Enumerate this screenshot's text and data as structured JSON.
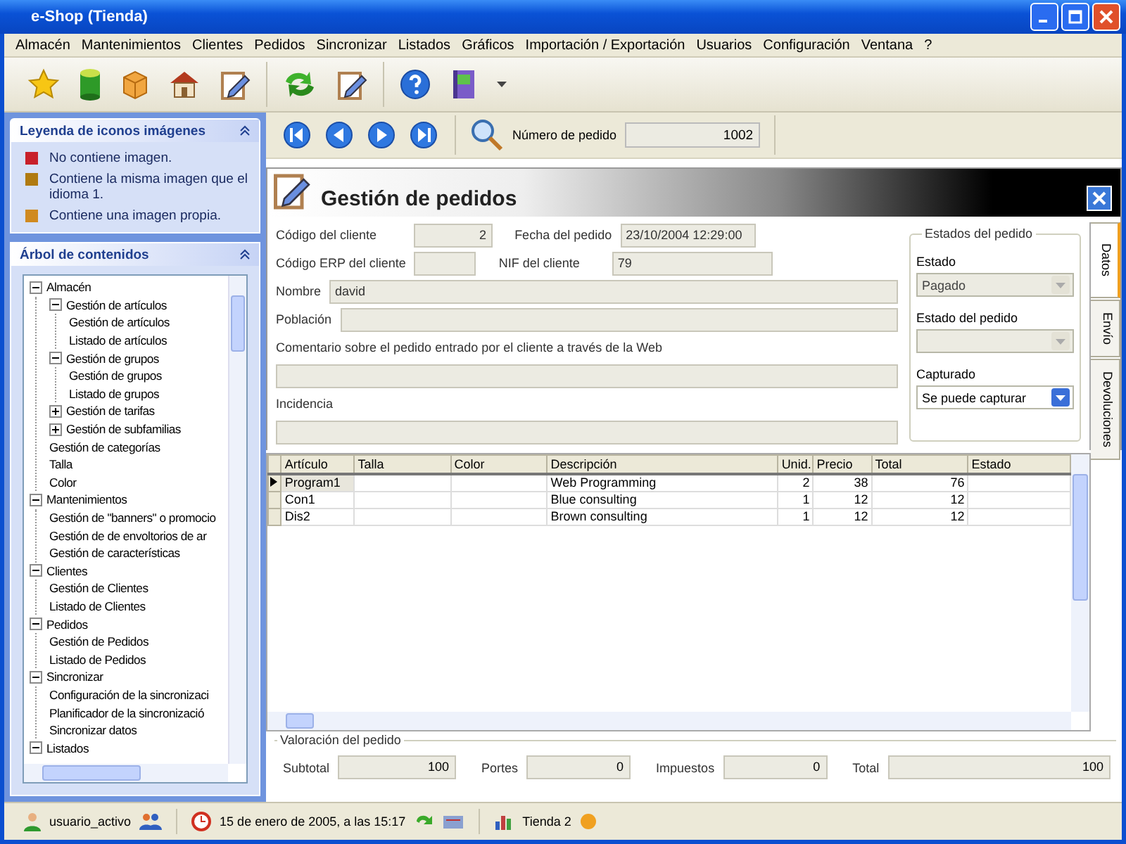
{
  "window": {
    "title": "e-Shop (Tienda)"
  },
  "menu": [
    "Almacén",
    "Mantenimientos",
    "Clientes",
    "Pedidos",
    "Sincronizar",
    "Listados",
    "Gráficos",
    "Importación / Exportación",
    "Usuarios",
    "Configuración",
    "Ventana",
    "?"
  ],
  "legend": {
    "title": "Leyenda de iconos imágenes",
    "items": [
      {
        "label": "No contiene imagen.",
        "color": "#c8202a"
      },
      {
        "label": "Contiene la misma imagen que el idioma 1.",
        "color": "#b07a10"
      },
      {
        "label": "Contiene una imagen propia.",
        "color": "#d08a20"
      }
    ]
  },
  "tree": {
    "title": "Árbol de contenidos",
    "items": [
      {
        "label": "Almacén",
        "expanded": true,
        "children": [
          {
            "label": "Gestión de artículos",
            "expanded": true,
            "children": [
              {
                "label": "Gestión de artículos"
              },
              {
                "label": "Listado de artículos"
              }
            ]
          },
          {
            "label": "Gestión de grupos",
            "expanded": true,
            "children": [
              {
                "label": "Gestión de grupos"
              },
              {
                "label": "Listado de grupos"
              }
            ]
          },
          {
            "label": "Gestión de tarifas",
            "expanded": false
          },
          {
            "label": "Gestión de subfamilias",
            "expanded": false
          },
          {
            "label": "Gestión de categorías"
          },
          {
            "label": "Talla"
          },
          {
            "label": "Color"
          }
        ]
      },
      {
        "label": "Mantenimientos",
        "expanded": true,
        "children": [
          {
            "label": "Gestión de \"banners\" o promocio"
          },
          {
            "label": "Gestión de de envoltorios de ar"
          },
          {
            "label": "Gestión de características"
          }
        ]
      },
      {
        "label": "Clientes",
        "expanded": true,
        "children": [
          {
            "label": "Gestión de Clientes"
          },
          {
            "label": "Listado de Clientes"
          }
        ]
      },
      {
        "label": "Pedidos",
        "expanded": true,
        "children": [
          {
            "label": "Gestión de Pedidos"
          },
          {
            "label": "Listado de Pedidos"
          }
        ]
      },
      {
        "label": "Sincronizar",
        "expanded": true,
        "children": [
          {
            "label": "Configuración de la sincronizaci"
          },
          {
            "label": "Planificador de la sincronizació"
          },
          {
            "label": "Sincronizar datos"
          }
        ]
      },
      {
        "label": "Listados",
        "expanded": true
      }
    ]
  },
  "navigator": {
    "search_label": "Número de pedido",
    "search_value": "1002"
  },
  "form": {
    "title": "Gestión de pedidos",
    "customer_code": {
      "label": "Código del cliente",
      "value": "2"
    },
    "order_date": {
      "label": "Fecha del pedido",
      "value": "23/10/2004 12:29:00"
    },
    "erp_code": {
      "label": "Código ERP del cliente"
    },
    "nif": {
      "label": "NIF del cliente",
      "value": "79"
    },
    "name": {
      "label": "Nombre",
      "value": "david"
    },
    "town": {
      "label": "Población"
    },
    "comment": {
      "label": "Comentario sobre el pedido entrado por el cliente a través de la Web"
    },
    "incident": {
      "label": "Incidencia"
    },
    "states": {
      "title": "Estados del pedido",
      "selects": [
        {
          "label": "Estado",
          "value": "Pagado",
          "disabled": true
        },
        {
          "label": "Estado del pedido",
          "disabled": true
        },
        {
          "label": "Capturado",
          "value": "Se puede capturar",
          "disabled": false
        }
      ]
    }
  },
  "tabs": [
    {
      "label": "Datos",
      "selected": true
    },
    {
      "label": "Envío",
      "selected": false
    },
    {
      "label": "Devoluciones",
      "selected": false
    }
  ],
  "grid": {
    "columns": [
      "Artículo",
      "Talla",
      "Color",
      "Descripción",
      "Unid.",
      "Precio",
      "Total",
      "Estado"
    ],
    "rows": [
      {
        "cells": [
          "Program1",
          "",
          "",
          "Web Programming",
          "2",
          "38",
          "76",
          ""
        ],
        "selected": true
      },
      {
        "cells": [
          "Con1",
          "",
          "",
          "Blue consulting",
          "1",
          "12",
          "12",
          ""
        ],
        "selected": false
      },
      {
        "cells": [
          "Dis2",
          "",
          "",
          "Brown consulting",
          "1",
          "12",
          "12",
          ""
        ],
        "selected": false
      }
    ]
  },
  "totals": {
    "title": "Valoración del pedido",
    "items": [
      {
        "label": "Subtotal",
        "value": "100"
      },
      {
        "label": "Portes",
        "value": "0"
      },
      {
        "label": "Impuestos",
        "value": "0"
      },
      {
        "label": "Total",
        "value": "100"
      }
    ]
  },
  "status_bar": {
    "user": "usuario_activo",
    "datetime": "15 de enero de 2005, a las 15:17",
    "store": "Tienda 2"
  }
}
